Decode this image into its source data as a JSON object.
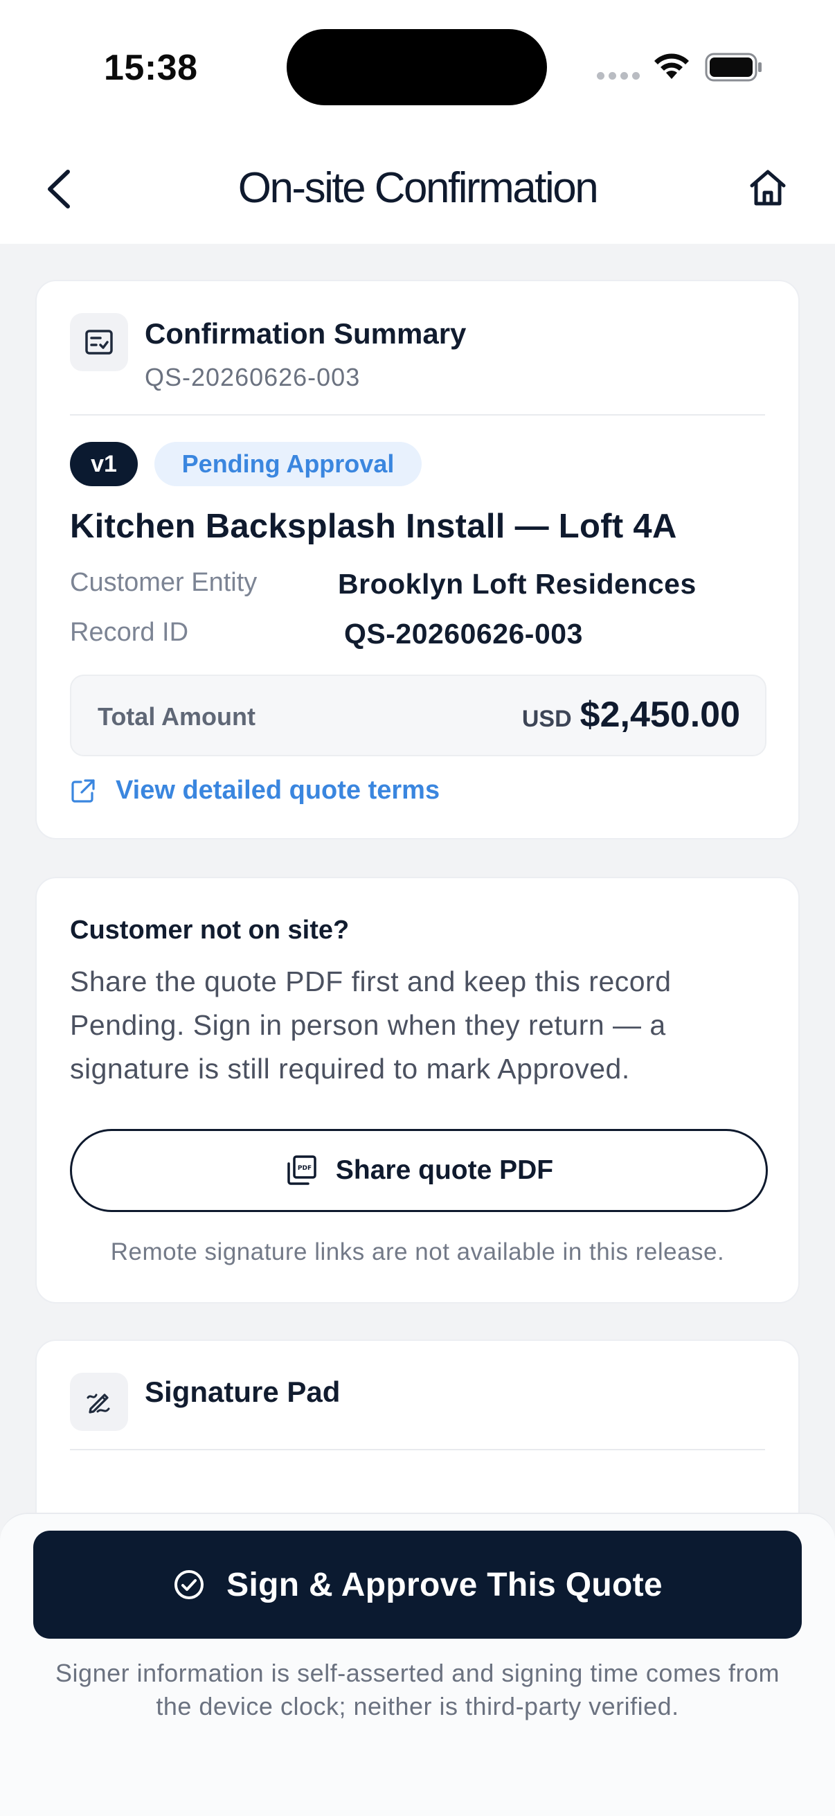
{
  "status_bar": {
    "time": "15:38"
  },
  "nav": {
    "title": "On-site Confirmation"
  },
  "summary": {
    "title": "Confirmation Summary",
    "subtitle": "QS-20260626-003",
    "version_badge": "v1",
    "status_badge": "Pending Approval",
    "project_title": "Kitchen Backsplash Install — Loft 4A",
    "fields": [
      {
        "label": "Customer Entity",
        "value": "Brooklyn Loft Residences"
      },
      {
        "label": "Record ID",
        "value": "QS-20260626-003"
      }
    ],
    "total_label": "Total Amount",
    "currency": "USD",
    "total_value": "$2,450.00",
    "terms_link": "View detailed quote terms"
  },
  "notice": {
    "title": "Customer not on site?",
    "body": "Share the quote PDF first and keep this record Pending. Sign in person when they return — a signature is still required to mark Approved.",
    "share_button": "Share quote PDF",
    "remote_note": "Remote signature links are not available in this release."
  },
  "signature": {
    "title": "Signature Pad"
  },
  "footer": {
    "approve_button": "Sign & Approve This Quote",
    "disclaimer": "Signer information is self-asserted and signing time comes from the device clock; neither is third-party verified."
  },
  "colors": {
    "primary_dark": "#0b1a30",
    "accent_blue": "#3a86df",
    "badge_blue_bg": "#e8f1fd",
    "page_bg": "#f2f3f5"
  },
  "icons": [
    "chevron-left-icon",
    "home-icon",
    "checklist-icon",
    "external-link-icon",
    "pdf-icon",
    "signature-icon",
    "check-circle-icon",
    "wifi-icon",
    "battery-icon",
    "signal-icon"
  ]
}
